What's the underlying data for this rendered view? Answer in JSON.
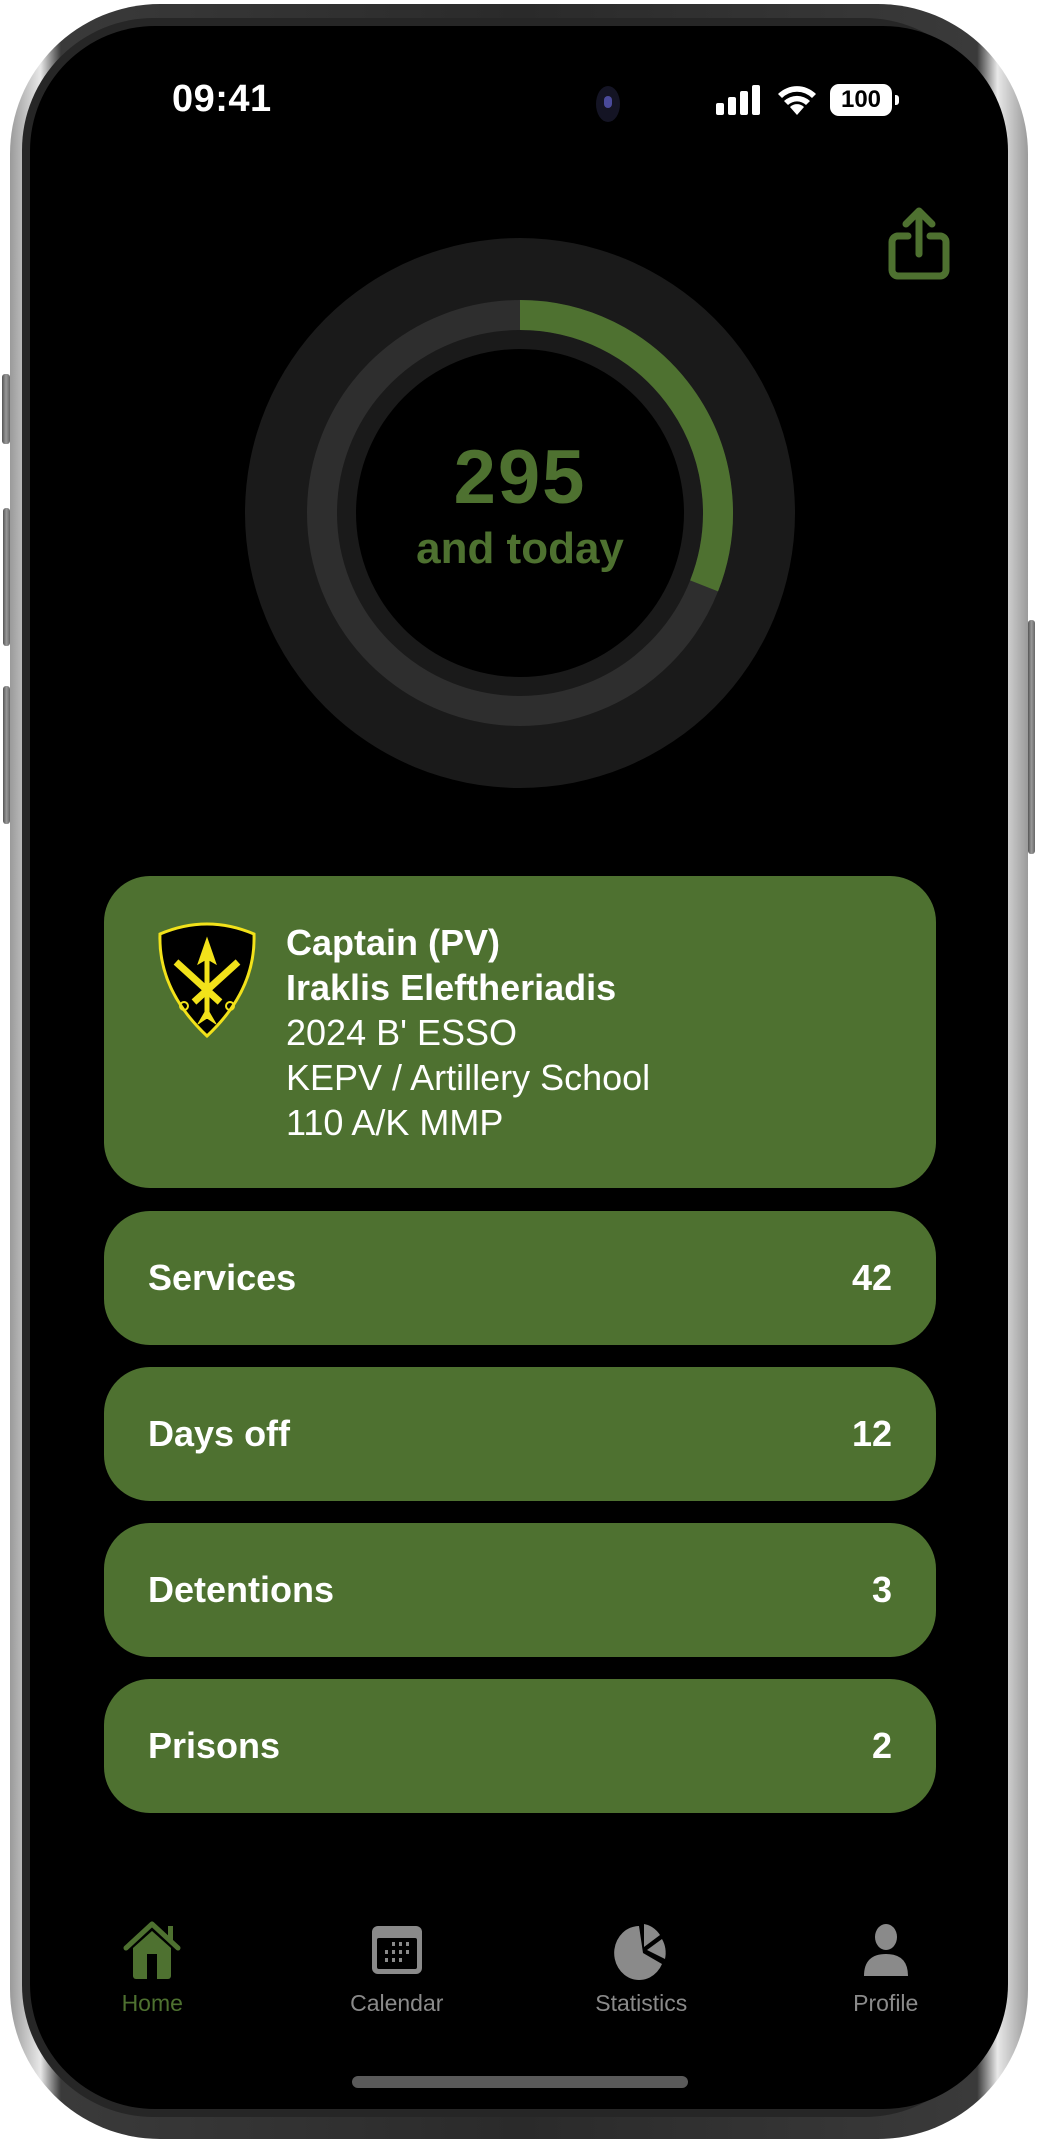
{
  "status_bar": {
    "time": "09:41",
    "battery": "100",
    "icons": [
      "cellular-signal-icon",
      "wifi-icon",
      "battery-icon"
    ]
  },
  "header": {
    "share_icon": "share-icon"
  },
  "progress_ring": {
    "value": "295",
    "caption": "and today",
    "progress_fraction": 0.31,
    "colors": {
      "progress": "#4e7130",
      "track": "#2e2e2e",
      "outer": "#1a1a1a"
    }
  },
  "profile": {
    "rank": "Captain (PV)",
    "name": "Iraklis Eleftheriadis",
    "class": "2024 B' ESSO",
    "unit": "KEPV / Artillery School",
    "specialty": "110 A/K MMP",
    "insignia_icon": "artillery-insignia-icon"
  },
  "stats": [
    {
      "label": "Services",
      "value": "42"
    },
    {
      "label": "Days off",
      "value": "12"
    },
    {
      "label": "Detentions",
      "value": "3"
    },
    {
      "label": "Prisons",
      "value": "2"
    }
  ],
  "tabbar": {
    "items": [
      {
        "label": "Home",
        "icon": "house-icon",
        "active": true
      },
      {
        "label": "Calendar",
        "icon": "calendar-icon",
        "active": false
      },
      {
        "label": "Statistics",
        "icon": "pie-chart-icon",
        "active": false
      },
      {
        "label": "Profile",
        "icon": "person-icon",
        "active": false
      }
    ]
  },
  "colors": {
    "accent": "#4e7130",
    "background": "#000000",
    "inactive": "#8a8a8a",
    "text": "#ffffff"
  }
}
